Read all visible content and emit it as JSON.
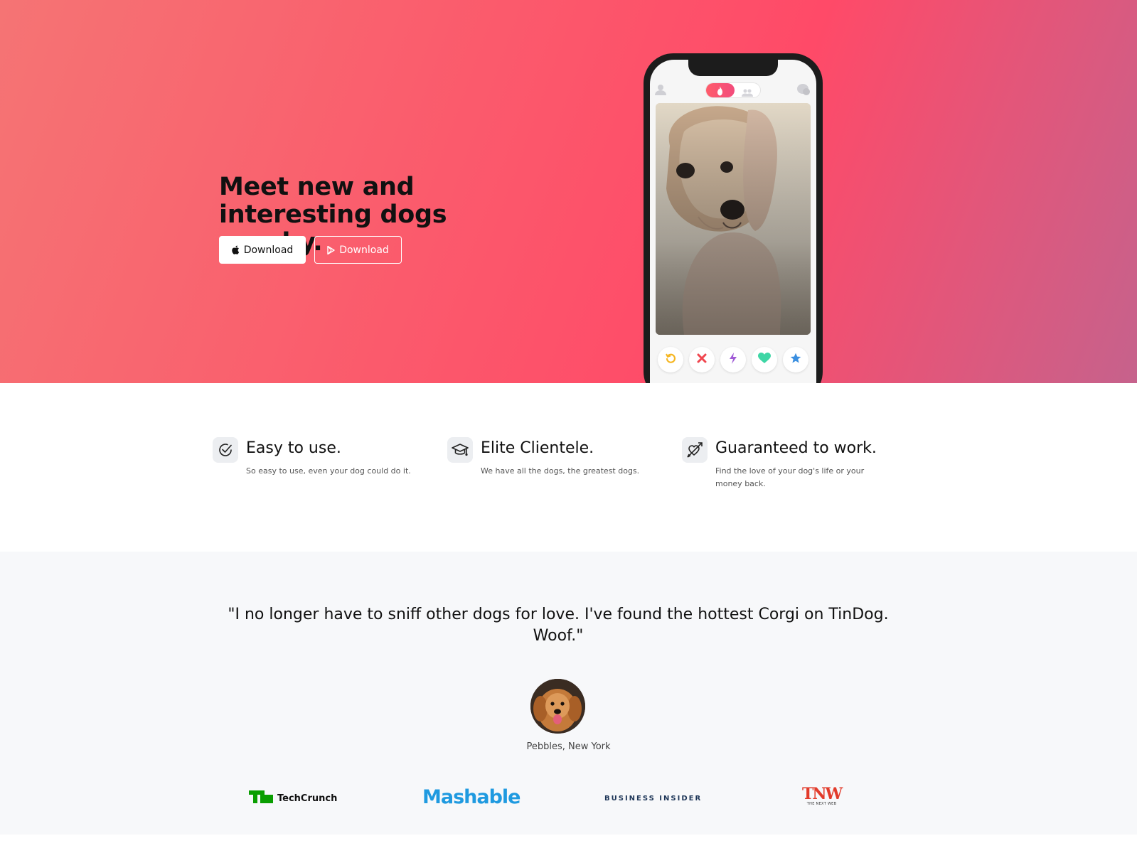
{
  "hero": {
    "title": "Meet new and interesting dogs nearby.",
    "apple_button_label": "Download",
    "play_button_label": "Download"
  },
  "phone": {
    "actions": [
      "rewind-icon",
      "close-icon",
      "bolt-icon",
      "heart-icon",
      "star-icon"
    ]
  },
  "features": [
    {
      "title": "Easy to use.",
      "text": "So easy to use, even your dog could do it.",
      "icon": "check-circle-icon"
    },
    {
      "title": "Elite Clientele.",
      "text": "We have all the dogs, the greatest dogs.",
      "icon": "graduation-cap-icon"
    },
    {
      "title": "Guaranteed to work.",
      "text": "Find the love of your dog's life or your money back.",
      "icon": "heart-arrow-icon"
    }
  ],
  "testimonial": {
    "quote": "\"I no longer have to sniff other dogs for love. I've found the hottest Corgi on TinDog. Woof.\"",
    "author": "Pebbles, New York"
  },
  "press": {
    "techcrunch": "TechCrunch",
    "techcrunch_mark": "TC",
    "mashable": "Mashable",
    "business_insider": "BUSINESS INSIDER",
    "tnw": "TNW",
    "tnw_sub": "THE NEXT WEB"
  },
  "colors": {
    "hero_gradient_start": "#f57474",
    "hero_gradient_mid": "#ff4a68",
    "hero_gradient_end": "#c6628c",
    "mashable_blue": "#1f9ae0",
    "techcrunch_green": "#0a9e01",
    "tnw_red": "#e23b2b"
  }
}
